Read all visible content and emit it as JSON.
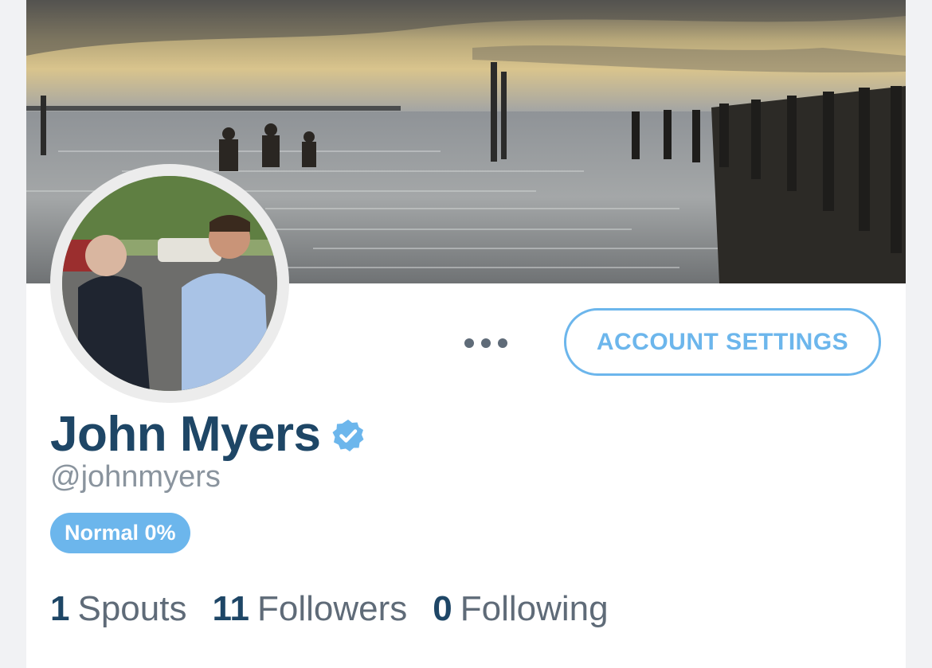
{
  "profile": {
    "display_name": "John Myers",
    "handle": "@johnmyers",
    "verified": true,
    "status_badge": "Normal 0%"
  },
  "actions": {
    "more_icon": "ellipsis-icon",
    "settings_label": "ACCOUNT SETTINGS"
  },
  "stats": {
    "spouts_count": "1",
    "spouts_label": "Spouts",
    "followers_count": "11",
    "followers_label": "Followers",
    "following_count": "0",
    "following_label": "Following"
  },
  "colors": {
    "accent": "#6cb6ec",
    "name": "#1e4666",
    "muted": "#8a949e"
  }
}
